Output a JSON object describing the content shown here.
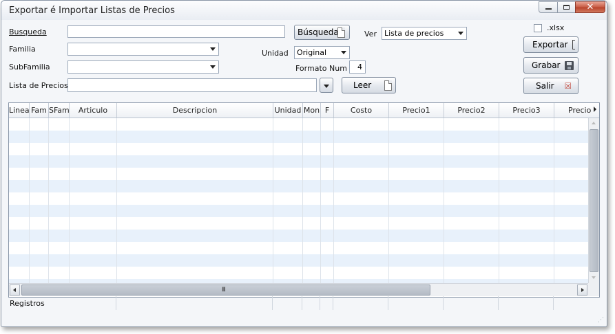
{
  "window": {
    "title": "Exportar é Importar Listas de Precios"
  },
  "form": {
    "busqueda_label": "Busqueda",
    "busqueda_value": "",
    "familia_label": "Familia",
    "familia_value": "",
    "subfamilia_label": "SubFamilia",
    "subfamilia_value": "",
    "lista_precios_label": "Lista de Precios",
    "lista_precios_value": "",
    "busqueda_button": "Búsqueda",
    "ver_label": "Ver",
    "ver_value": "Lista de precios",
    "unidad_label": "Unidad",
    "unidad_value": "Original",
    "formato_num_label": "Formato Num",
    "formato_num_value": "4",
    "leer_button": "Leer",
    "xlsx_label": ".xlsx",
    "xlsx_checked": false,
    "exportar_button": "Exportar",
    "grabar_button": "Grabar",
    "salir_button": "Salir"
  },
  "grid": {
    "columns": [
      "Linea",
      "Fam",
      "SFam",
      "Articulo",
      "Descripcion",
      "Unidad",
      "Mon",
      "F",
      "Costo",
      "Precio1",
      "Precio2",
      "Precio3",
      "Precio"
    ],
    "scroll_grip": "III",
    "footer_label": "Registros"
  },
  "icons": {
    "minimize": "minimize-icon",
    "maximize": "maximize-icon",
    "close": "close-icon",
    "document": "document-icon",
    "save": "floppy-disk-icon",
    "exit": "exit-icon"
  },
  "colors": {
    "row_alt": "#e8f1fb",
    "close_button": "#c75b43",
    "window_bg": "#f4f6f9"
  }
}
